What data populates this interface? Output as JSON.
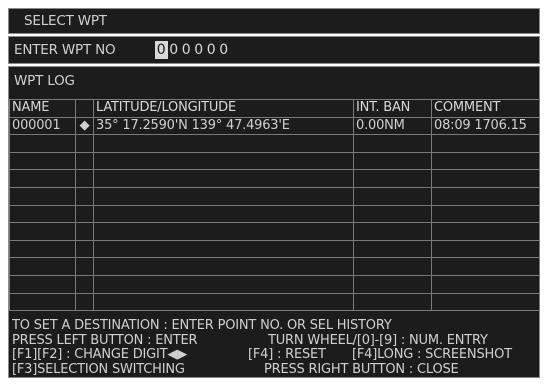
{
  "title": "SELECT WPT",
  "entry": {
    "label": "ENTER WPT NO",
    "digits": [
      "0",
      "0",
      "0",
      "0",
      "0",
      "0"
    ],
    "active_digit": 0
  },
  "log": {
    "label": "WPT LOG",
    "columns": [
      "NAME",
      "",
      "LATITUDE/LONGITUDE",
      "INT. BAN",
      "COMMENT"
    ],
    "rows": [
      {
        "name": "000001",
        "marker": "arrow-left-icon",
        "position": "35° 17.2590'N 139° 47.4963'E",
        "int_ban": "0.00NM",
        "comment": "08:09 1706.15"
      }
    ],
    "empty_rows": 10
  },
  "help": {
    "line1": "TO SET A DESTINATION : ENTER POINT NO. OR SEL HISTORY",
    "line2a": "PRESS LEFT BUTTON : ENTER",
    "line2b": "TURN WHEEL/[0]-[9] : NUM. ENTRY",
    "line3a": "[F1][F2] : CHANGE DIGIT◀▶",
    "line3b": "[F4] : RESET",
    "line3c": "[F4]LONG : SCREENSHOT",
    "line4a": "[F3]SELECTION SWITCHING",
    "line4b": "PRESS RIGHT BUTTON : CLOSE"
  },
  "colors": {
    "background": "#1c1c1c",
    "text": "#d0d0d0",
    "marker": "#f0d020",
    "grid": "#7a7a7a"
  }
}
